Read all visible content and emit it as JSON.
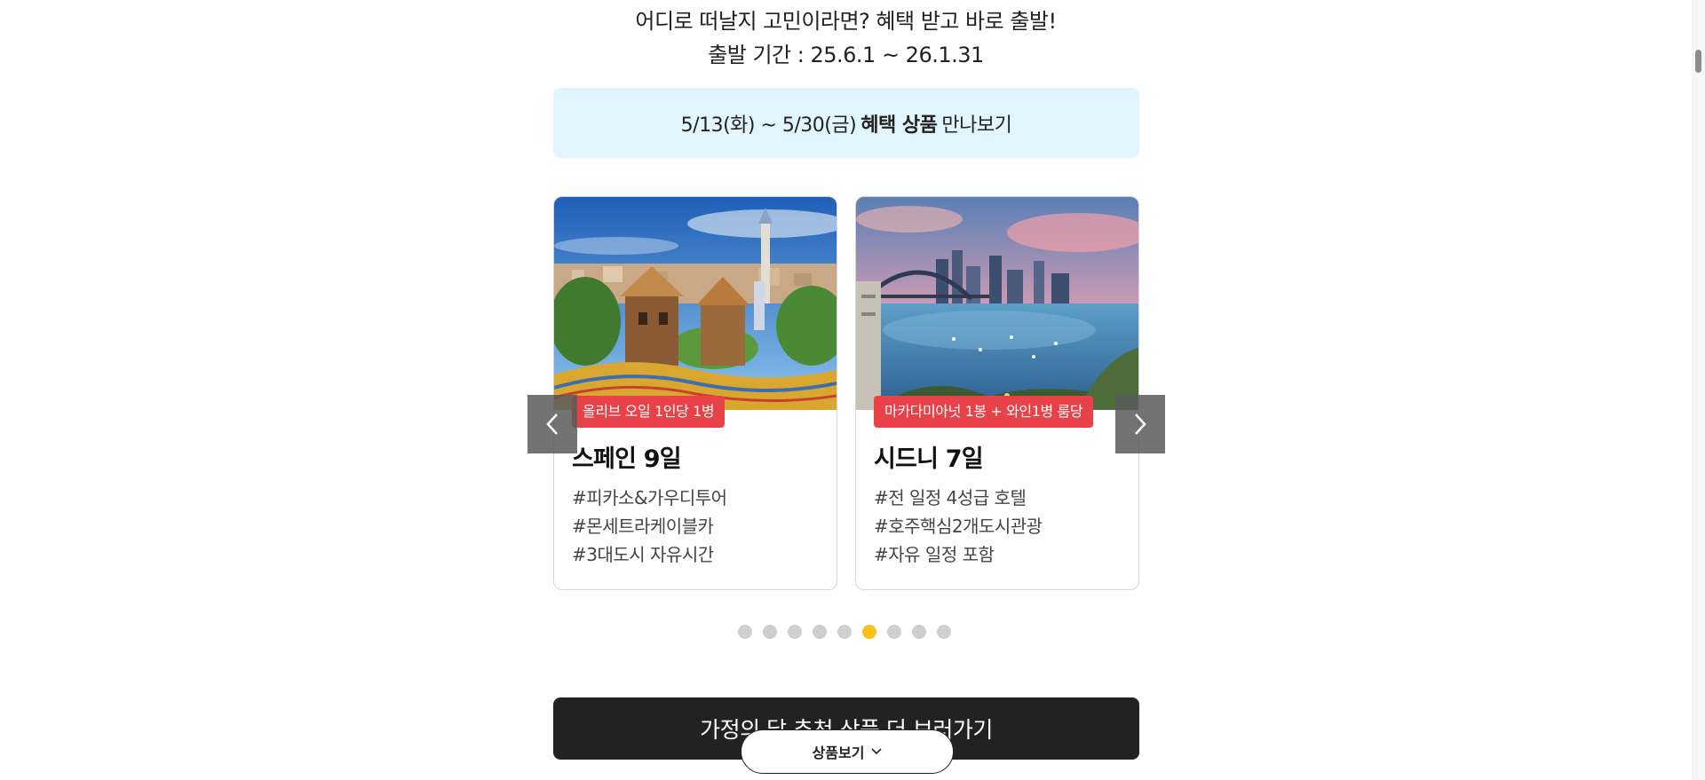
{
  "intro": {
    "line1": "어디로 떠날지 고민이라면? 혜택 받고 바로 출발!",
    "line2": "출발 기간 : 25.6.1 ~ 26.1.31"
  },
  "banner": {
    "date_text": "5/13(화) ~ 5/30(금)",
    "bold_text": "혜택 상품",
    "tail_text": "만나보기"
  },
  "cards": [
    {
      "image": "spain-park-guell-photo",
      "badge": "올리브 오일 1인당 1병",
      "title": "스페인 9일",
      "tags": [
        "#피카소&가우디투어",
        "#몬세트라케이블카",
        "#3대도시 자유시간"
      ]
    },
    {
      "image": "sydney-harbour-photo",
      "badge": "마카다미아넛 1봉 + 와인1병 룸당",
      "title": "시드니 7일",
      "tags": [
        "#전 일정 4성급 호텔",
        "#호주핵심2개도시관광",
        "#자유 일정 포함"
      ]
    }
  ],
  "carousel": {
    "prev_icon": "chevron-left-icon",
    "next_icon": "chevron-right-icon",
    "dot_count": 9,
    "active_dot": 6
  },
  "more_button": {
    "label": "가정의 달 추천 상품 더 보러가기"
  },
  "float_button": {
    "label": "상품보기",
    "icon": "chevron-down-icon"
  },
  "colors": {
    "banner_bg": "#e2f4fd",
    "badge": "#e84148",
    "active_dot": "#f7c21e",
    "dot": "#cfcfcf",
    "dark_button": "#222222"
  }
}
